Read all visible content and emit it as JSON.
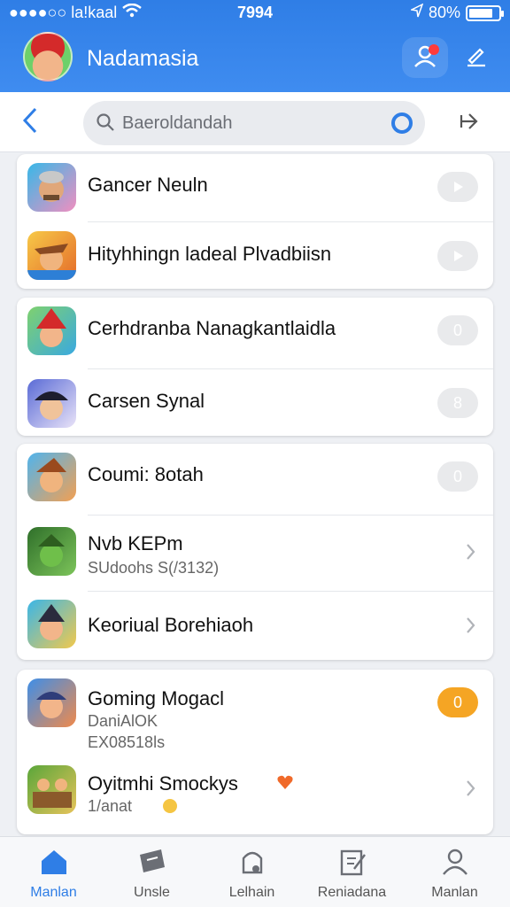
{
  "status_bar": {
    "carrier": "●●●●○○ la!kaal",
    "time": "7994",
    "battery": "80%",
    "battery_level": 0.8
  },
  "header": {
    "title": "Nadamasia",
    "notification_dot": true
  },
  "search": {
    "value": "Baeroldandah"
  },
  "cards": [
    {
      "rows": [
        {
          "title": "Gancer Neuln",
          "subtitles": [],
          "trailing": "toggle-play",
          "pill_text": ""
        },
        {
          "title": "Hityhhingn ladeal Plvadbiisn",
          "subtitles": [],
          "trailing": "toggle-play",
          "pill_text": ""
        }
      ]
    },
    {
      "rows": [
        {
          "title": "Cerhdranba Nanagkantlaidla",
          "subtitles": [],
          "trailing": "pill",
          "pill_text": "0"
        },
        {
          "title": "Carsen Synal",
          "subtitles": [],
          "trailing": "pill",
          "pill_text": "8"
        }
      ]
    },
    {
      "rows": [
        {
          "title": "Coumi: 8otah",
          "subtitles": [],
          "trailing": "pill",
          "pill_text": "0"
        },
        {
          "title": "Nvb KEPm",
          "subtitles": [
            "SUdoohs S(/3132)"
          ],
          "trailing": "chevron",
          "pill_text": ""
        },
        {
          "title": "Keoriual Borehiaoh",
          "subtitles": [],
          "trailing": "chevron",
          "pill_text": ""
        }
      ]
    },
    {
      "rows": [
        {
          "title": "Goming Mogacl",
          "subtitles": [
            "DaniAlOK",
            "EX08518ls"
          ],
          "trailing": "pill-orange",
          "pill_text": "0"
        },
        {
          "title": "Oyitmhi Smockys",
          "subtitles": [
            "1/anat"
          ],
          "trailing": "chevron",
          "pill_text": ""
        }
      ]
    }
  ],
  "tabs": [
    {
      "label": "Manlan",
      "icon": "home-icon",
      "active": true
    },
    {
      "label": "Unsle",
      "icon": "ticket-icon",
      "active": false
    },
    {
      "label": "Lelhain",
      "icon": "lock-profile-icon",
      "active": false
    },
    {
      "label": "Reniadana",
      "icon": "clipboard-edit-icon",
      "active": false
    },
    {
      "label": "Manlan",
      "icon": "person-icon",
      "active": false
    }
  ],
  "colors": {
    "accent": "#2f7ee6",
    "badge_orange": "#f5a524",
    "notification": "#ff3b3b"
  }
}
